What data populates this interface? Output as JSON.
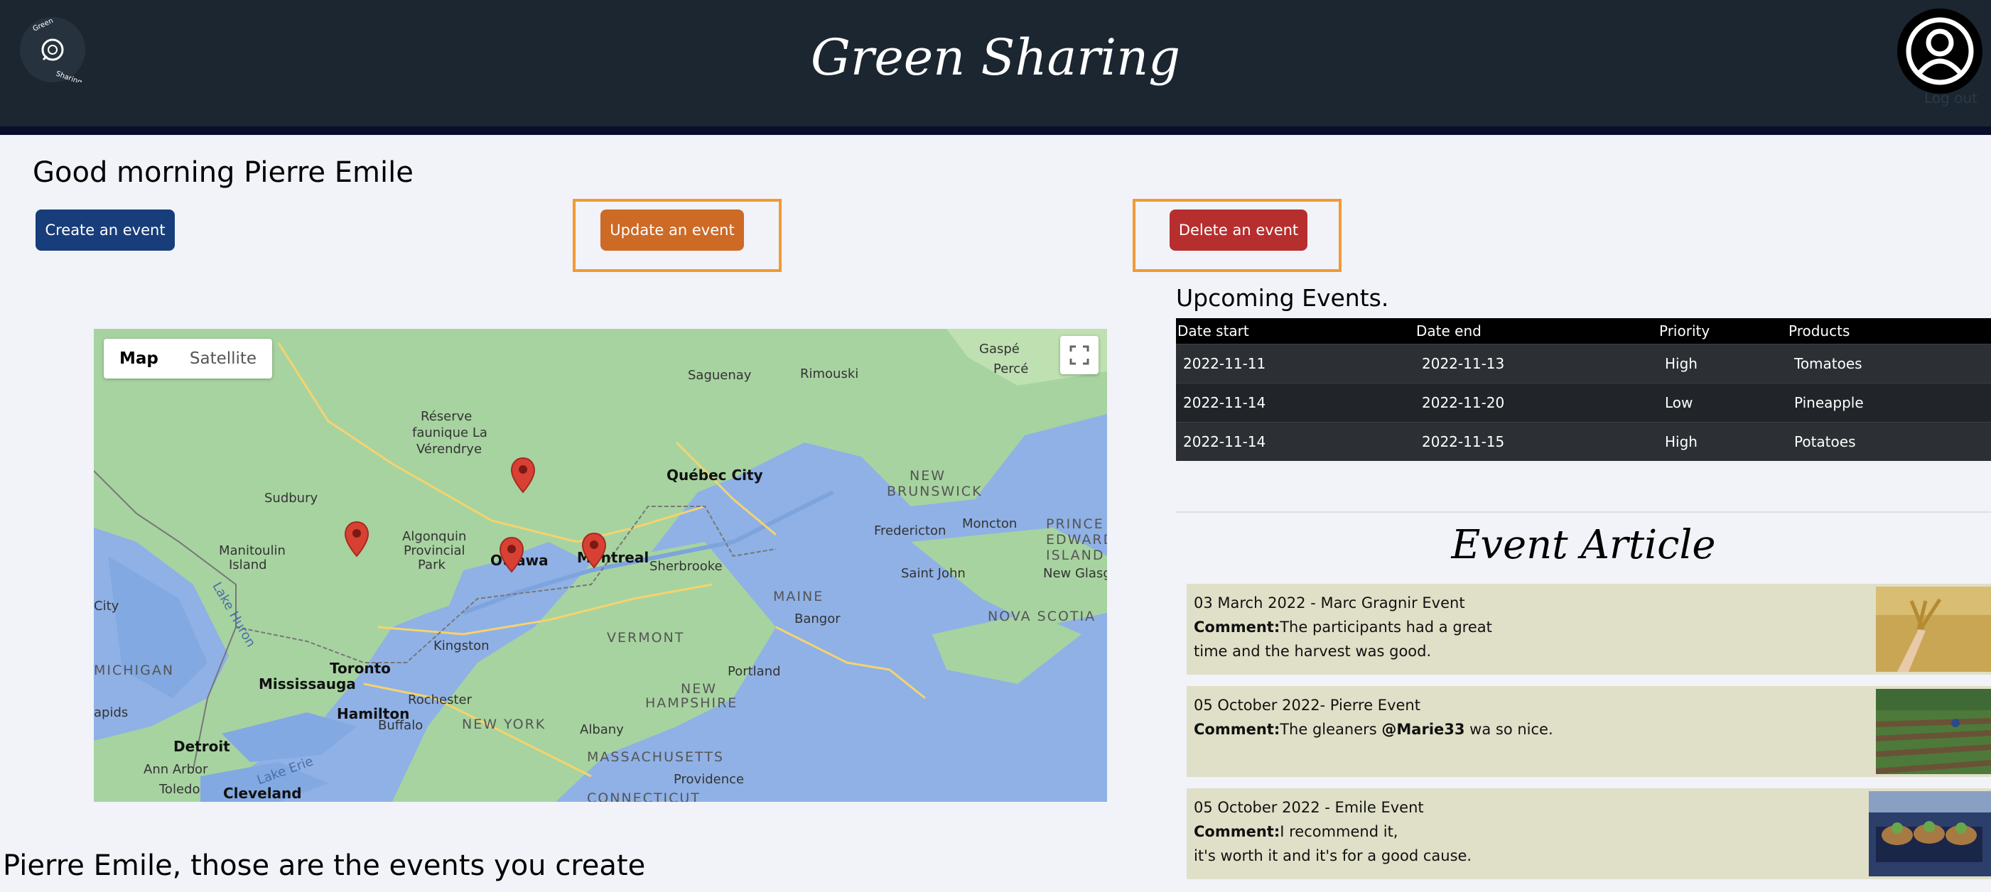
{
  "header": {
    "title": "Green Sharing",
    "logo_text_top": "Green",
    "logo_text_bottom": "Sharing",
    "logout_label": "Log out"
  },
  "greeting": "Good morning Pierre Emile",
  "actions": {
    "create_label": "Create an event",
    "update_label": "Update an event",
    "delete_label": "Delete an event"
  },
  "map": {
    "map_type_options": [
      "Map",
      "Satellite"
    ],
    "selected_map_type": "Map",
    "labels": {
      "gaspe": "Gaspé",
      "perce": "Percé",
      "saguenay": "Saguenay",
      "rimouski": "Rimouski",
      "reserve_1": "Réserve",
      "reserve_2": "faunique La",
      "reserve_3": "Vérendrye",
      "quebec": "Québec City",
      "new_brunswick_1": "NEW",
      "new_brunswick_2": "BRUNSWICK",
      "sudbury": "Sudbury",
      "algonquin_1": "Algonquin",
      "algonquin_2": "Provincial",
      "algonquin_3": "Park",
      "manitoulin_1": "Manitoulin",
      "manitoulin_2": "Island",
      "ottawa": "Ottawa",
      "montreal": "Montreal",
      "sherbrooke": "Sherbrooke",
      "fredericton": "Fredericton",
      "moncton": "Moncton",
      "pei_1": "PRINCE",
      "pei_2": "EDWARD",
      "pei_3": "ISLAND",
      "new_glasgow": "New Glasgow",
      "saint_john": "Saint John",
      "lake_huron": "Lake Huron",
      "maine": "MAINE",
      "bangor": "Bangor",
      "nova_scotia": "NOVA SCOTIA",
      "city": "City",
      "vermont": "VERMONT",
      "kingston": "Kingston",
      "michigan": "MICHIGAN",
      "toronto": "Toronto",
      "mississauga": "Mississauga",
      "hamilton": "Hamilton",
      "rochester": "Rochester",
      "buffalo": "Buffalo",
      "new_hampshire_1": "NEW",
      "new_hampshire_2": "HAMPSHIRE",
      "portland": "Portland",
      "new_york": "NEW YORK",
      "albany": "Albany",
      "apids": "apids",
      "detroit": "Detroit",
      "ann_arbor": "Ann Arbor",
      "lake_erie": "Lake Erie",
      "massachusetts": "MASSACHUSETTS",
      "providence": "Providence",
      "toledo": "Toledo",
      "cleveland": "Cleveland",
      "connecticut": "CONNECTICUT"
    }
  },
  "upcoming": {
    "title": "Upcoming Events.",
    "columns": [
      "Date start",
      "Date end",
      "Priority",
      "Products"
    ],
    "rows": [
      [
        "2022-11-11",
        "2022-11-13",
        "High",
        "Tomatoes"
      ],
      [
        "2022-11-14",
        "2022-11-20",
        "Low",
        "Pineapple"
      ],
      [
        "2022-11-14",
        "2022-11-15",
        "High",
        "Potatoes"
      ]
    ]
  },
  "articles": {
    "title": "Event Article",
    "comment_label": "Comment:",
    "items": [
      {
        "heading": "03 March 2022 - Marc Gragnir Event",
        "comment_line1": "The participants had a great",
        "comment_line2": "time and the harvest was good."
      },
      {
        "heading": "05 October 2022- Pierre Event",
        "comment_pre": "The gleaners ",
        "mention": "@Marie33",
        "comment_post": " wa so nice."
      },
      {
        "heading": "05 October 2022 - Emile Event",
        "comment_line1": "I recommend it,",
        "comment_line2": "it's worth it and it's for a good cause."
      }
    ]
  },
  "my_events_heading": "Pierre Emile, those are the events you create",
  "colors": {
    "header_bg": "#1b2631",
    "create": "#173d7a",
    "update": "#cd6a26",
    "delete": "#b72e2e",
    "highlight": "#f29a34",
    "card_bg": "#e0e0c8"
  }
}
